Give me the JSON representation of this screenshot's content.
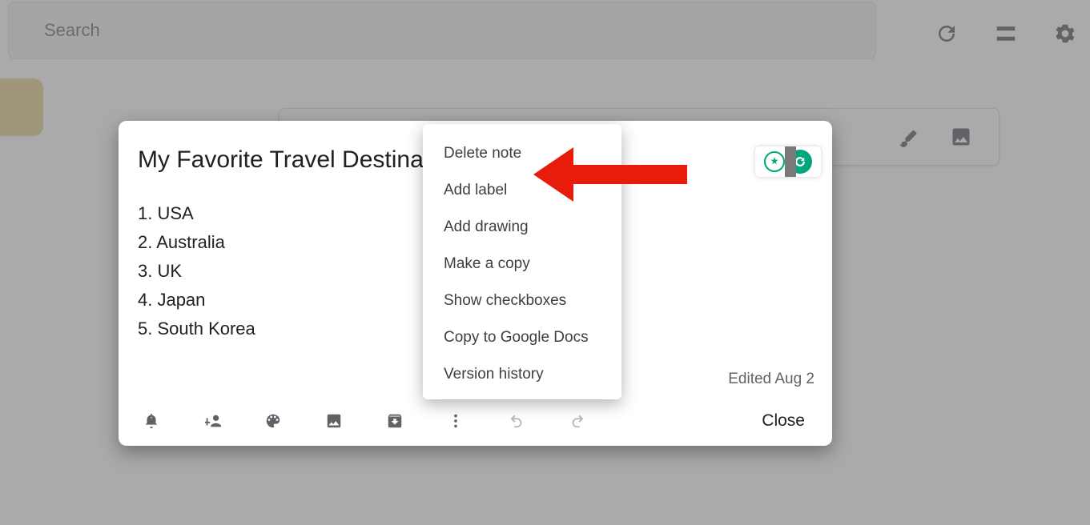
{
  "search": {
    "placeholder": "Search"
  },
  "note": {
    "title": "My Favorite Travel Destinations",
    "lines": [
      "1. USA",
      "2. Australia",
      "3. UK",
      "4. Japan",
      "5. South Korea"
    ],
    "edited": "Edited Aug 2",
    "close_label": "Close"
  },
  "menu": {
    "items": [
      "Delete note",
      "Add label",
      "Add drawing",
      "Make a copy",
      "Show checkboxes",
      "Copy to Google Docs",
      "Version history"
    ]
  },
  "toolbar_icons": [
    "remind",
    "collaborator",
    "palette",
    "image",
    "archive",
    "more",
    "undo",
    "redo"
  ]
}
